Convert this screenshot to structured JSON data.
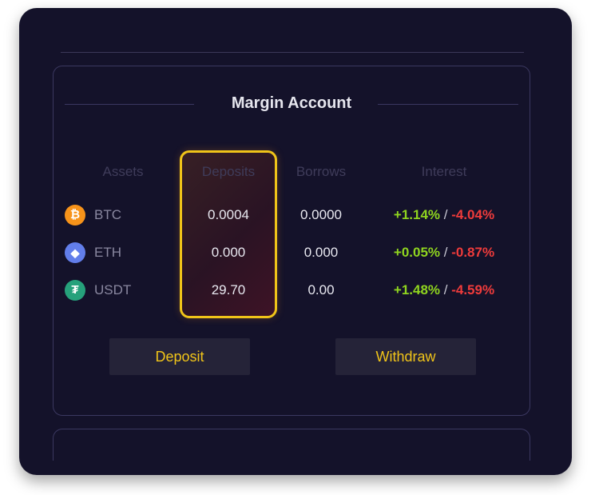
{
  "title": "Margin Account",
  "columns": {
    "assets": "Assets",
    "deposits": "Deposits",
    "borrows": "Borrows",
    "interest": "Interest"
  },
  "rows": [
    {
      "asset": "BTC",
      "icon": "bitcoin-icon",
      "icon_glyph": "₿",
      "icon_color": "#f7931a",
      "deposit": "0.0004",
      "borrow": "0.0000",
      "interest_pos": "+1.14%",
      "separator": " / ",
      "interest_neg": "-4.04%"
    },
    {
      "asset": "ETH",
      "icon": "ethereum-icon",
      "icon_glyph": "◆",
      "icon_color": "#627eea",
      "deposit": "0.000",
      "borrow": "0.000",
      "interest_pos": "+0.05%",
      "separator": " / ",
      "interest_neg": "-0.87%"
    },
    {
      "asset": "USDT",
      "icon": "tether-icon",
      "icon_glyph": "₮",
      "icon_color": "#26a17b",
      "deposit": "29.70",
      "borrow": "0.00",
      "interest_pos": "+1.48%",
      "separator": " / ",
      "interest_neg": "-4.59%"
    }
  ],
  "buttons": {
    "deposit": "Deposit",
    "withdraw": "Withdraw"
  },
  "colors": {
    "background": "#14122a",
    "highlight_border": "#f0c419",
    "button_text": "#f0c419",
    "positive": "#8fd41f",
    "negative": "#ef3b3b"
  }
}
